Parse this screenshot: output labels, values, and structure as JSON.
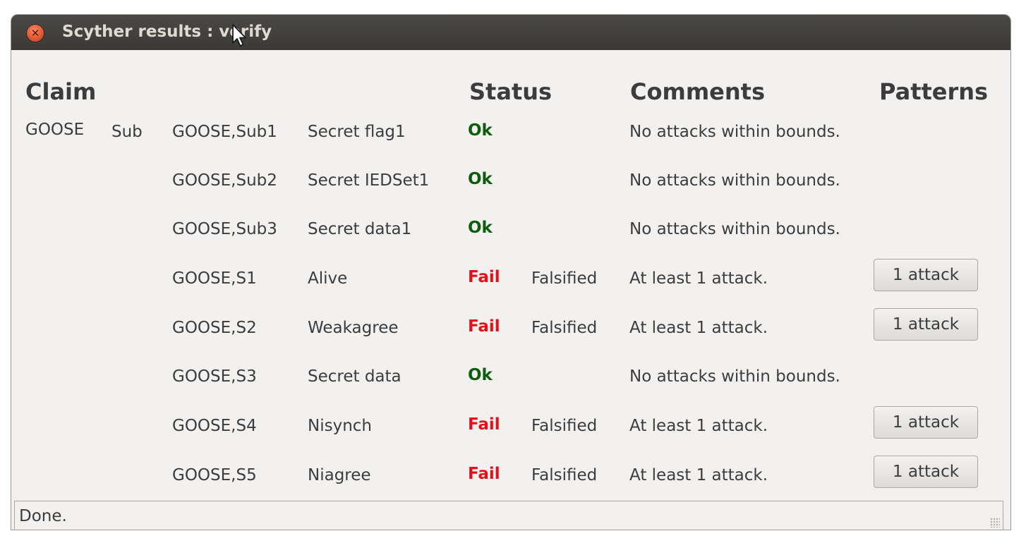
{
  "window": {
    "title": "Scyther results : verify",
    "close_icon": "close-icon"
  },
  "headers": {
    "claim": "Claim",
    "status": "Status",
    "comments": "Comments",
    "patterns": "Patterns"
  },
  "protocol": "GOOSE",
  "role": "Sub",
  "rows": [
    {
      "id": "GOOSE,Sub1",
      "claim": "Secret flag1",
      "status": "Ok",
      "detail": "",
      "comment": "No attacks within bounds.",
      "pattern": ""
    },
    {
      "id": "GOOSE,Sub2",
      "claim": "Secret IEDSet1",
      "status": "Ok",
      "detail": "",
      "comment": "No attacks within bounds.",
      "pattern": ""
    },
    {
      "id": "GOOSE,Sub3",
      "claim": "Secret data1",
      "status": "Ok",
      "detail": "",
      "comment": "No attacks within bounds.",
      "pattern": ""
    },
    {
      "id": "GOOSE,S1",
      "claim": "Alive",
      "status": "Fail",
      "detail": "Falsified",
      "comment": "At least 1 attack.",
      "pattern": "1 attack"
    },
    {
      "id": "GOOSE,S2",
      "claim": "Weakagree",
      "status": "Fail",
      "detail": "Falsified",
      "comment": "At least 1 attack.",
      "pattern": "1 attack"
    },
    {
      "id": "GOOSE,S3",
      "claim": "Secret data",
      "status": "Ok",
      "detail": "",
      "comment": "No attacks within bounds.",
      "pattern": ""
    },
    {
      "id": "GOOSE,S4",
      "claim": "Nisynch",
      "status": "Fail",
      "detail": "Falsified",
      "comment": "At least 1 attack.",
      "pattern": "1 attack"
    },
    {
      "id": "GOOSE,S5",
      "claim": "Niagree",
      "status": "Fail",
      "detail": "Falsified",
      "comment": "At least 1 attack.",
      "pattern": "1 attack"
    }
  ],
  "colors": {
    "ok": "#0e5c0e",
    "fail": "#e4111b",
    "titlebar": "#3b3a37",
    "window_bg": "#f2f1f0"
  },
  "statusbar": {
    "text": "Done."
  }
}
